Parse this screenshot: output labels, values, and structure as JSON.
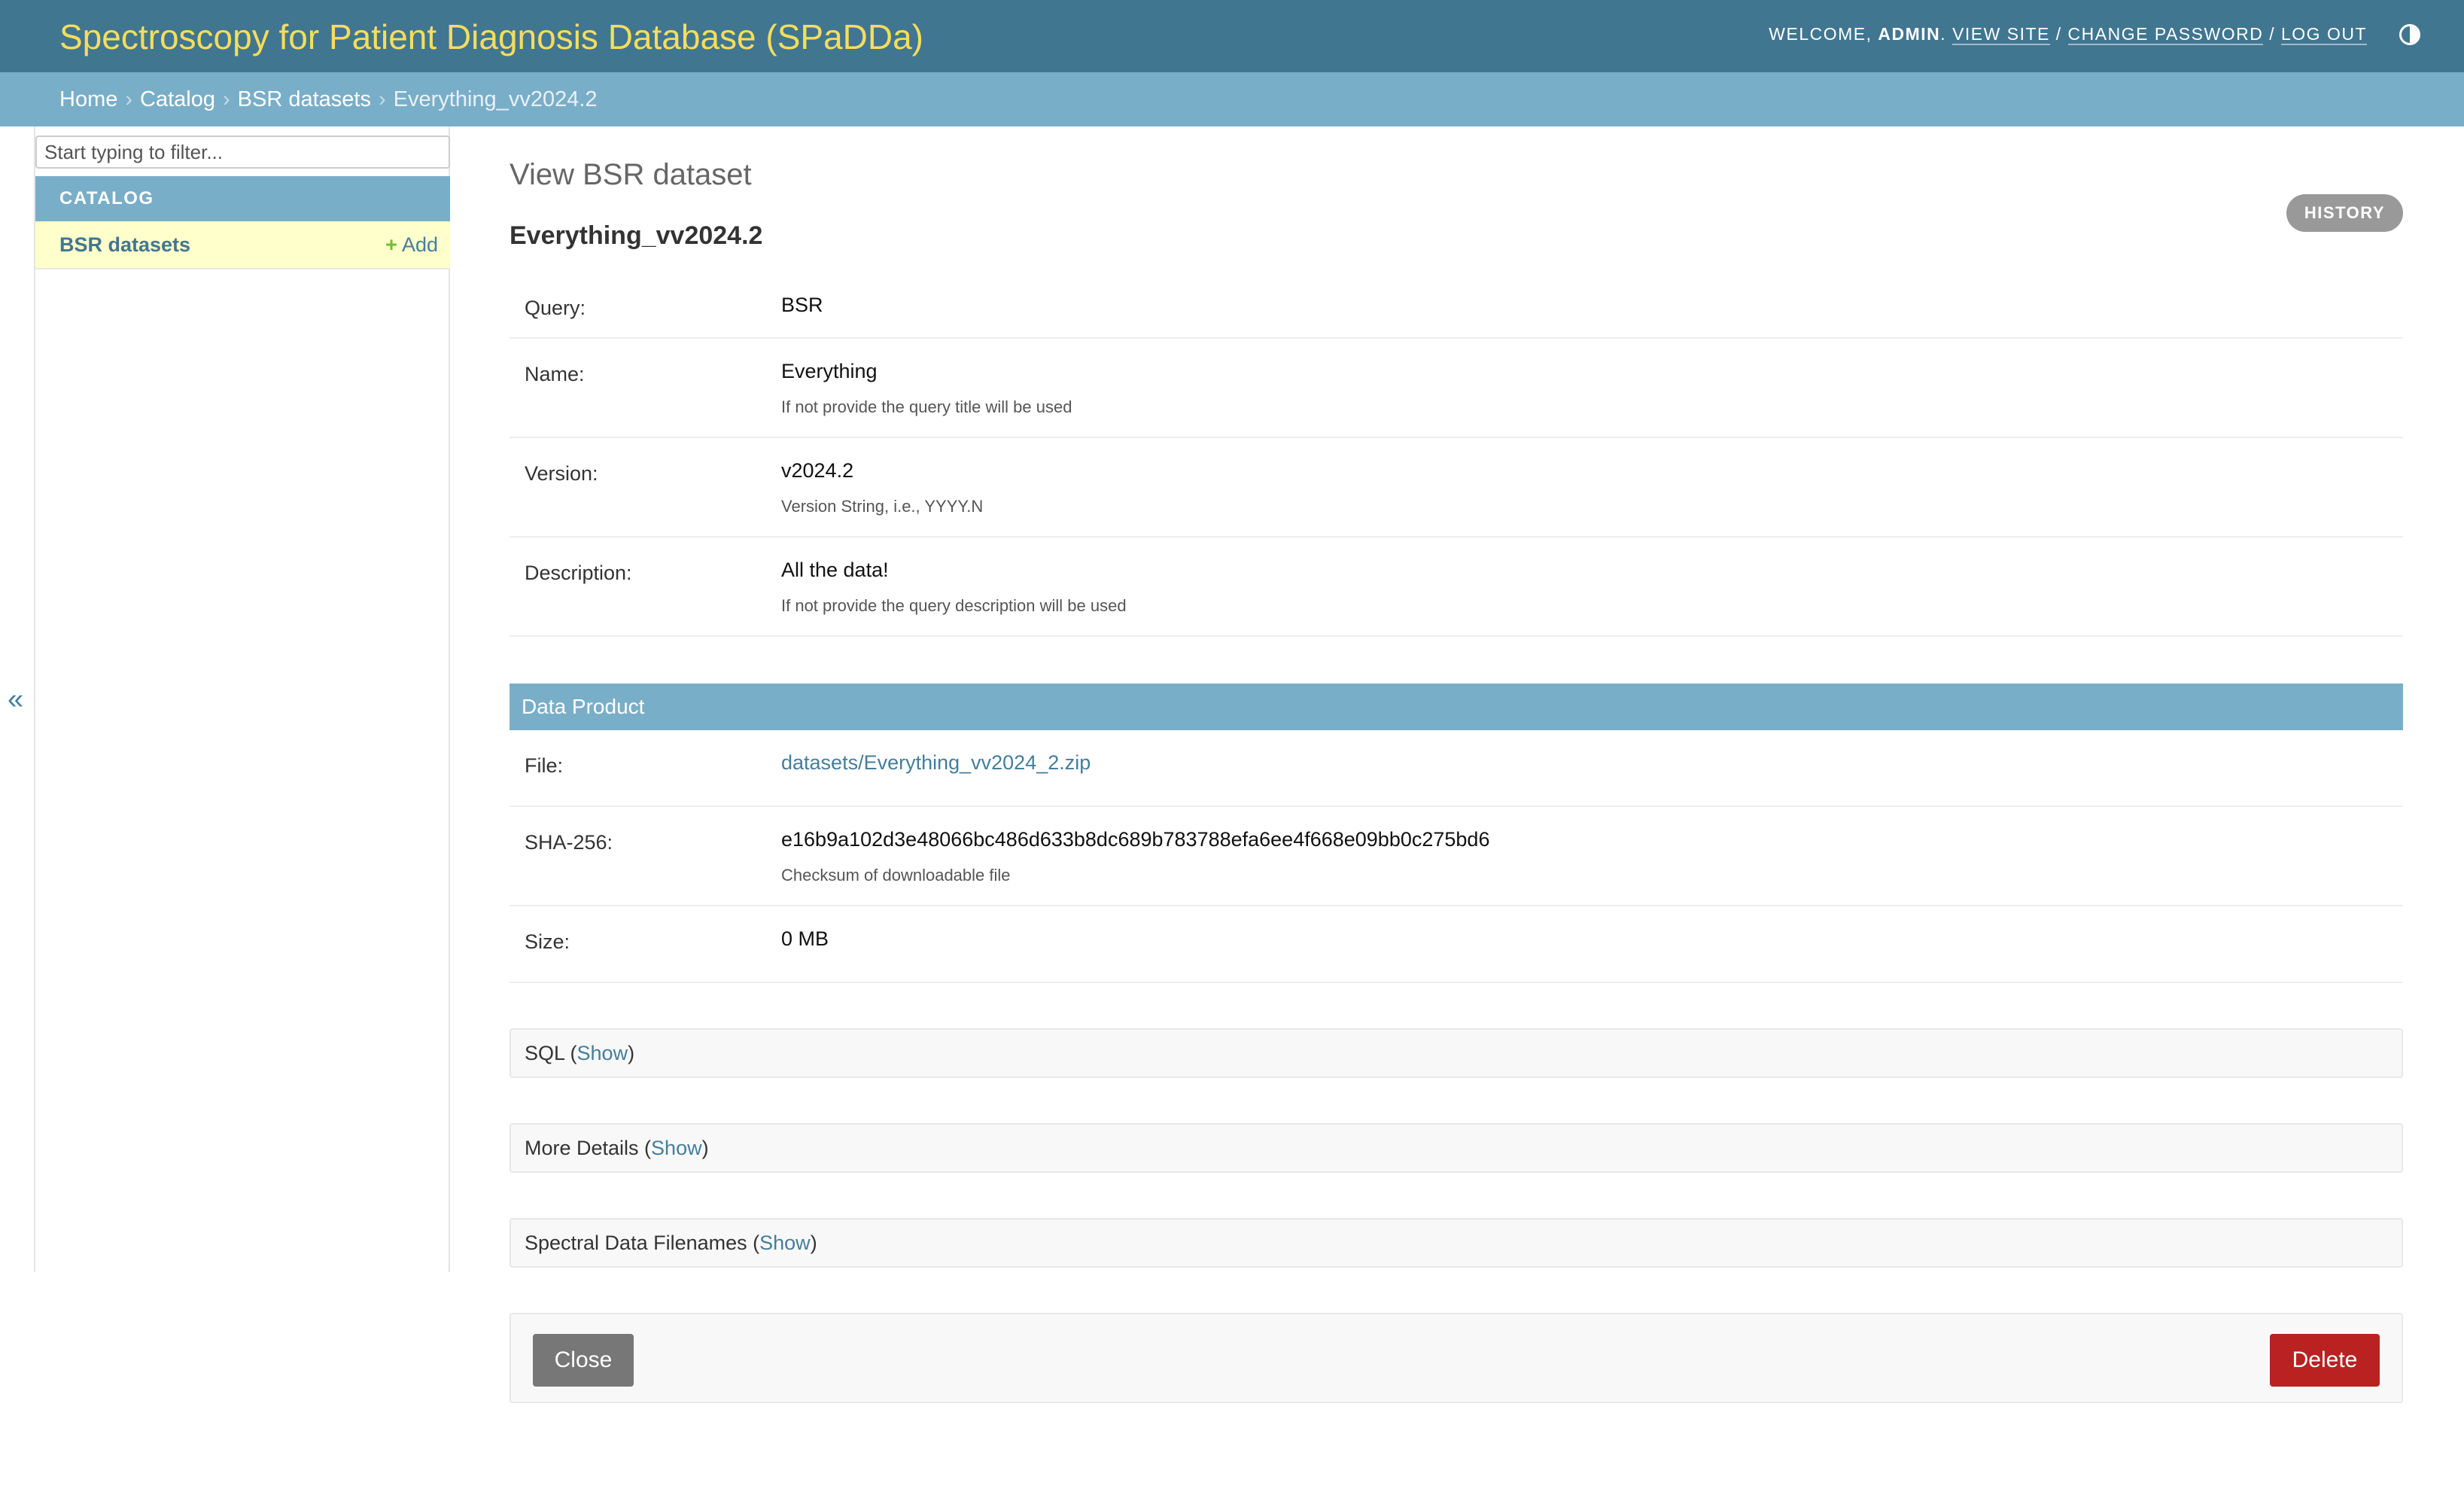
{
  "header": {
    "brand": "Spectroscopy for Patient Diagnosis Database (SPaDDa)",
    "welcome": "WELCOME,",
    "username": "ADMIN",
    "view_site": "VIEW SITE",
    "change_password": "CHANGE PASSWORD",
    "log_out": "LOG OUT",
    "separator": "/",
    "theme_icon": "half-circle-icon"
  },
  "breadcrumbs": {
    "items": [
      "Home",
      "Catalog",
      "BSR datasets"
    ],
    "current": "Everything_vv2024.2",
    "separator": "›"
  },
  "sidebar": {
    "filter_placeholder": "Start typing to filter...",
    "module_caption": "CATALOG",
    "model_label": "BSR datasets",
    "add_label": "Add",
    "add_icon": "+",
    "collapse_icon": "«"
  },
  "main": {
    "page_title": "View BSR dataset",
    "history_label": "HISTORY",
    "object_title": "Everything_vv2024.2",
    "fields": [
      {
        "label": "Query:",
        "value": "BSR",
        "help": ""
      },
      {
        "label": "Name:",
        "value": "Everything",
        "help": "If not provide the query title will be used"
      },
      {
        "label": "Version:",
        "value": "v2024.2",
        "help": "Version String, i.e., YYYY.N"
      },
      {
        "label": "Description:",
        "value": "All the data!",
        "help": "If not provide the query description will be used"
      }
    ],
    "data_product": {
      "caption": "Data Product",
      "fields": [
        {
          "label": "File:",
          "value": "datasets/Everything_vv2024_2.zip",
          "help": ""
        },
        {
          "label": "SHA-256:",
          "value": "e16b9a102d3e48066bc486d633b8dc689b783788efa6ee4f668e09bb0c275bd6",
          "help": "Checksum of downloadable file"
        },
        {
          "label": "Size:",
          "value": "0 MB",
          "help": ""
        }
      ]
    },
    "collapsibles": [
      {
        "label": "SQL",
        "toggle": "Show"
      },
      {
        "label": "More Details",
        "toggle": "Show"
      },
      {
        "label": "Spectral Data Filenames",
        "toggle": "Show"
      }
    ],
    "close_label": "Close",
    "delete_label": "Delete"
  },
  "colors": {
    "header_bg": "#417690",
    "brand": "#f5dd5d",
    "breadcrumb_bg": "#79aec8",
    "link": "#447e9b",
    "delete": "#ba2121",
    "selected_row": "#ffffcc"
  }
}
